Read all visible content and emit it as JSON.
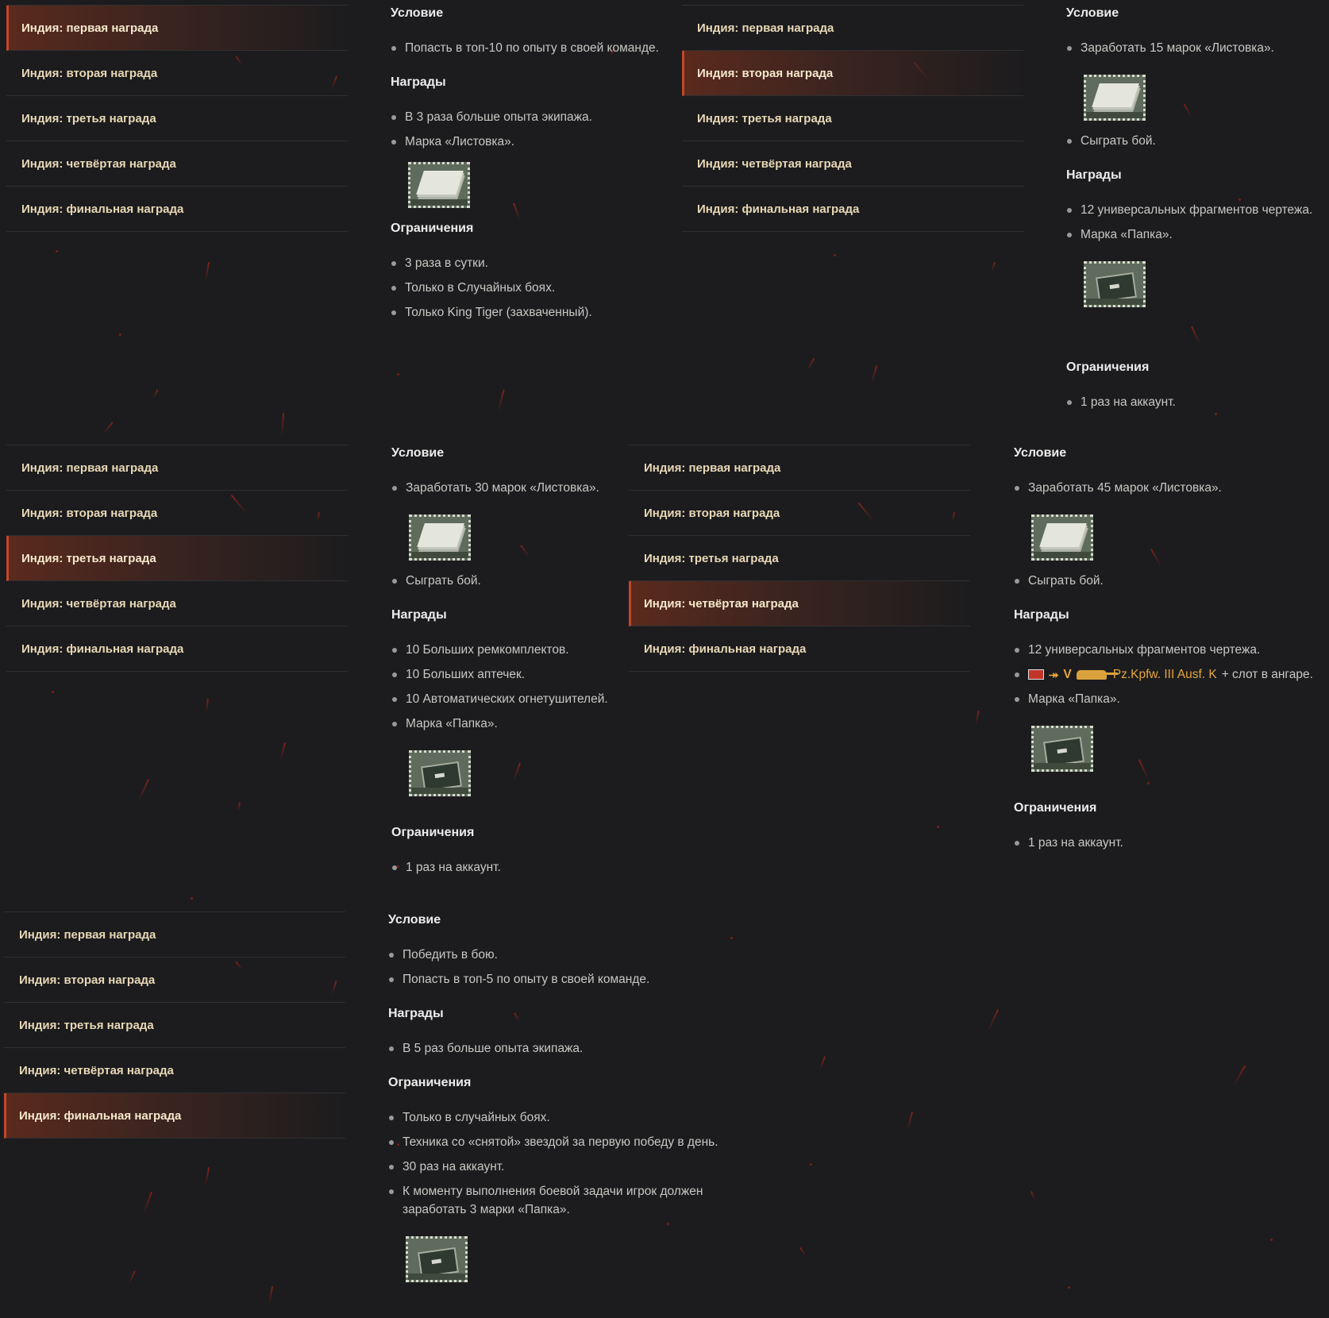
{
  "menu_items": [
    "Индия: первая награда",
    "Индия: вторая награда",
    "Индия: третья награда",
    "Индия: четвёртая награда",
    "Индия: финальная награда"
  ],
  "labels": {
    "condition": "Условие",
    "rewards": "Награды",
    "restrictions": "Ограничения"
  },
  "panels": [
    {
      "active_index": 0,
      "condition": [
        "Попасть в топ-10 по опыту в своей команде."
      ],
      "rewards": [
        "В 3 раза больше опыта экипажа.",
        "Марка «Листовка»."
      ],
      "reward_stamp": "leaflet",
      "restrictions": [
        "3 раза в сутки.",
        "Только в Случайных боях.",
        "Только King Tiger (захваченный)."
      ]
    },
    {
      "active_index": 1,
      "condition_a": [
        "Заработать 15 марок «Листовка»."
      ],
      "condition_b": [
        "Сыграть бой."
      ],
      "rewards": [
        "12 универсальных фрагментов чертежа.",
        "Марка «Папка»."
      ],
      "restrictions": [
        "1 раз на аккаунт."
      ]
    },
    {
      "active_index": 2,
      "condition_a": [
        "Заработать 30 марок «Листовка»."
      ],
      "condition_b": [
        "Сыграть бой."
      ],
      "rewards": [
        "10 Больших ремкомплектов.",
        "10 Больших аптечек.",
        "10 Автоматических огнетушителей.",
        "Марка «Папка»."
      ],
      "restrictions": [
        "1 раз на аккаунт."
      ]
    },
    {
      "active_index": 3,
      "condition_a": [
        "Заработать 45 марок «Листовка»."
      ],
      "condition_b": [
        "Сыграть бой."
      ],
      "rewards_first": "12 универсальных фрагментов чертежа.",
      "tank_reward": {
        "tier": "V",
        "name": "Pz.Kpfw. III Ausf. K",
        "suffix": "+ слот в ангаре.",
        "flag_icon": "germany-flag-icon",
        "type_icon": "premium-tank-icon"
      },
      "rewards_last": "Марка «Папка».",
      "restrictions": [
        "1 раз на аккаунт."
      ]
    },
    {
      "active_index": 4,
      "condition": [
        "Победить в бою.",
        "Попасть в топ-5 по опыту в своей команде."
      ],
      "rewards": [
        "В 5 раз больше опыта экипажа."
      ],
      "restrictions": [
        "Только в случайных боях.",
        "Техника со «снятой» звездой за первую победу в день.",
        "30 раз на аккаунт.",
        "К моменту выполнения боевой задачи игрок должен заработать 3 марки «Папка»."
      ]
    }
  ],
  "colors": {
    "background": "#1c1c1e",
    "accent": "#c4462a",
    "menu_text": "#e8d8b6",
    "tank": "#e6a63a"
  }
}
